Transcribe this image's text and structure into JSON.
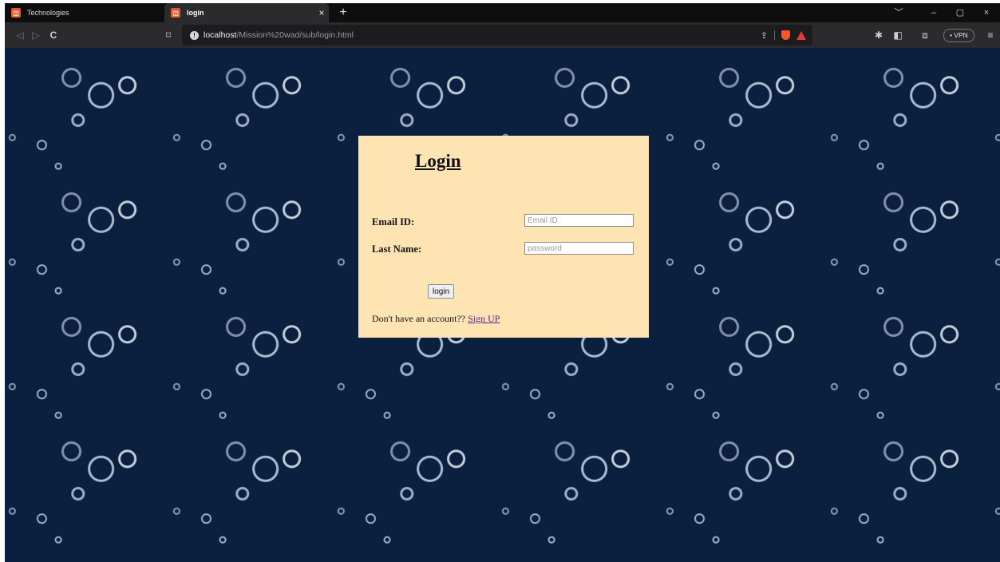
{
  "browser": {
    "tabs": [
      {
        "title": "Technologies",
        "active": false
      },
      {
        "title": "login",
        "active": true
      }
    ],
    "new_tab_symbol": "+",
    "close_symbol": "×",
    "window_controls": {
      "dropdown": "﹀",
      "minimize": "–",
      "maximize": "▢",
      "close": "×"
    },
    "nav": {
      "back": "◁",
      "forward": "▷",
      "reload": "C",
      "bookmark": "⌑"
    },
    "url": {
      "host": "localhost",
      "path": "/Mission%20wad/sub/login.html"
    },
    "extensions": {
      "puzzle": "✱",
      "sidebar": "◧",
      "wallet": "⧈",
      "vpn_label": "• VPN",
      "menu": "≡"
    }
  },
  "page": {
    "title": "Login",
    "email_label": "Email ID:",
    "email_placeholder": "Email ID",
    "password_label": "Last Name:",
    "password_placeholder": "password",
    "login_button": "login",
    "signup_prompt": "Don't have an account??",
    "signup_link": "Sign UP"
  },
  "colors": {
    "page_background": "#0b1f3f",
    "login_box": "#ffe4b3",
    "link": "#5a189a"
  }
}
